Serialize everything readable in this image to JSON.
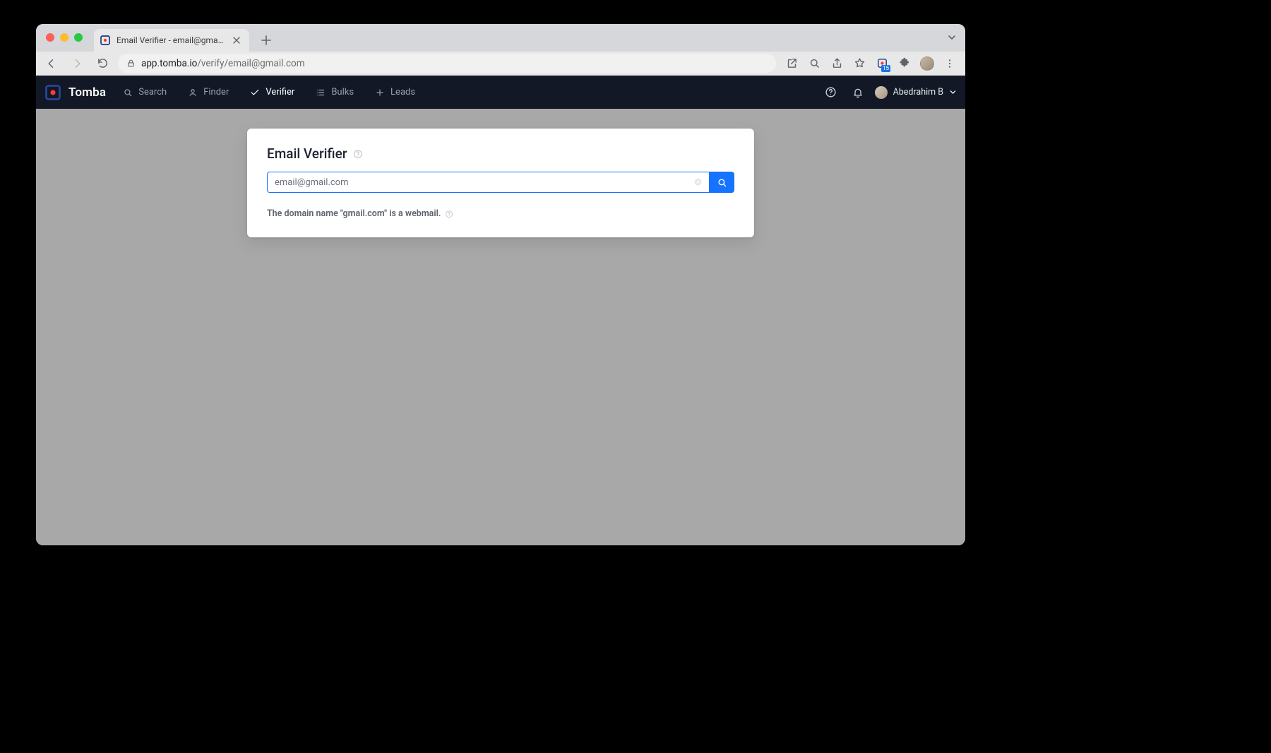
{
  "browser": {
    "tab_title": "Email Verifier - email@gmail.com",
    "url_domain": "app.tomba.io",
    "url_path": "/verify/email@gmail.com",
    "ext_badge": "15"
  },
  "nav": {
    "brand": "Tomba",
    "items": [
      {
        "label": "Search"
      },
      {
        "label": "Finder"
      },
      {
        "label": "Verifier"
      },
      {
        "label": "Bulks"
      },
      {
        "label": "Leads"
      }
    ],
    "user_name": "Abedrahim B"
  },
  "verifier": {
    "heading": "Email Verifier",
    "input_value": "email@gmail.com",
    "input_placeholder": "email@gmail.com",
    "result_text": "The domain name \"gmail.com\" is a webmail."
  }
}
